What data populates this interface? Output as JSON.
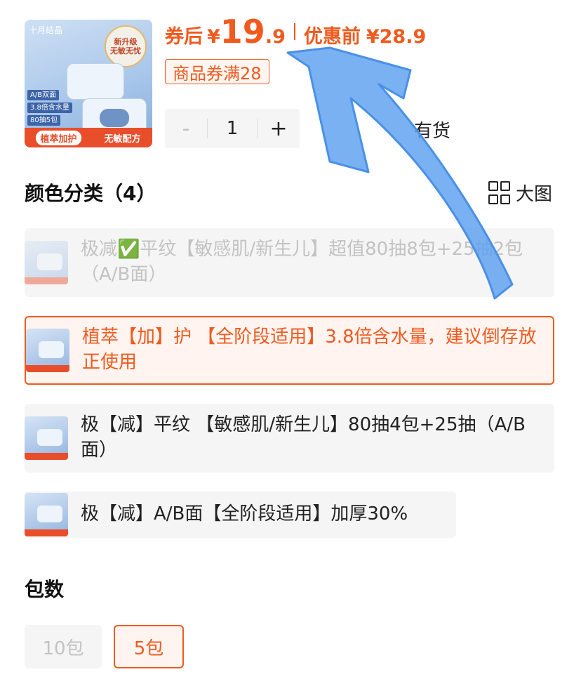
{
  "product_image": {
    "brand": "十月结晶",
    "seal_line1": "新升级",
    "seal_line2": "无敏无忧",
    "tags": [
      "A/B双面",
      "3.8倍含水量",
      "80抽5包"
    ],
    "bottom_left": "植萃加护",
    "bottom_right": "无敏配方"
  },
  "price": {
    "after_label": "券后",
    "currency": "¥",
    "after_int": "19",
    "after_dec": ".9",
    "before_label": "优惠前",
    "before_value": "¥28.9"
  },
  "coupon": {
    "text": "商品券满28"
  },
  "quantity": {
    "minus": "-",
    "value": "1",
    "plus": "+"
  },
  "stock": {
    "text": "有货"
  },
  "color_section": {
    "title": "颜色分类（4）",
    "big_view_label": "大图",
    "options": [
      {
        "label": "极减✅平纹【敏感肌/新生儿】超值80抽8包+25抽2包（A/B面）",
        "state": "disabled"
      },
      {
        "label": "植萃【加】护 【全阶段适用】3.8倍含水量，建议倒存放正使用",
        "state": "selected"
      },
      {
        "label": "极【减】平纹 【敏感肌/新生儿】80抽4包+25抽（A/B面）",
        "state": "normal"
      },
      {
        "label": "极【减】A/B面【全阶段适用】加厚30%",
        "state": "normal"
      }
    ]
  },
  "package_section": {
    "title": "包数",
    "options": [
      {
        "label": "10包",
        "state": "disabled"
      },
      {
        "label": "5包",
        "state": "selected"
      }
    ]
  },
  "colors": {
    "accent": "#f05a1e",
    "annotation_arrow": "#5ba0f0"
  }
}
